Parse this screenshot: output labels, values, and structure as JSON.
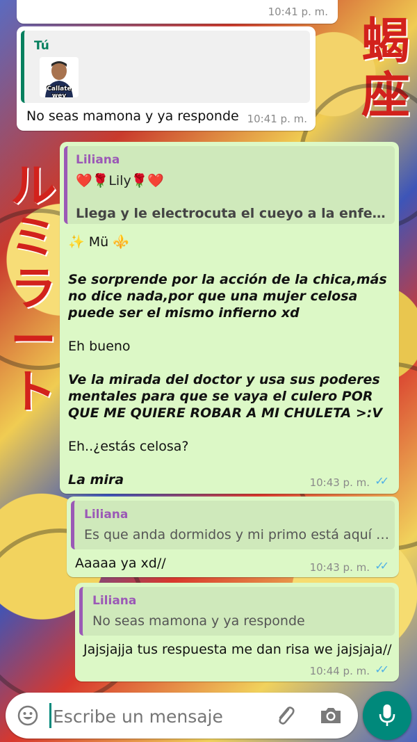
{
  "colors": {
    "outgoing_bubble": "#dcf8c6",
    "incoming_bubble": "#ffffff",
    "quote_author_you": "#06805f",
    "quote_author_liliana": "#9b59b6",
    "read_ticks": "#4fb0e6",
    "mic_button": "#00897b"
  },
  "messages": [
    {
      "time": "10:41 p. m."
    },
    {
      "quote_author": "Tú",
      "sticker_caption": "Callate wey",
      "text": "No seas mamona y ya responde",
      "time": "10:41 p. m."
    },
    {
      "quote_author": "Liliana",
      "quote_line1": "❤️🌹Lily🌹❤️",
      "quote_line2": "Llega y le electrocuta el cueyo a la enfermera...",
      "lines": [
        "✨ Mü ⚜️",
        "Se sorprende por la acción de la chica,más no dice nada,por que una mujer celosa puede ser el mismo infierno xd",
        "Eh bueno",
        "Ve la mirada del doctor y usa sus poderes mentales para que se vaya el culero POR QUE ME QUIERE ROBAR A MI CHULETA >:V",
        "Eh..¿estás celosa?",
        "La mira"
      ],
      "time": "10:43 p. m.",
      "status": "read"
    },
    {
      "quote_author": "Liliana",
      "quote_text": "Es que anda dormidos y mi primo está aquí :v//",
      "text": "Aaaaa ya xd//",
      "time": "10:43 p. m.",
      "status": "read"
    },
    {
      "quote_author": "Liliana",
      "quote_text": "No seas mamona y ya responde",
      "text": "Jajsjajja tus respuesta me dan risa we jajsjaja//",
      "time": "10:44 p. m.",
      "status": "read"
    }
  ],
  "composer": {
    "placeholder": "Escribe un mensaje",
    "emoji_icon": "emoji-icon",
    "attach_icon": "paperclip-icon",
    "camera_icon": "camera-icon",
    "mic_icon": "mic-icon"
  }
}
